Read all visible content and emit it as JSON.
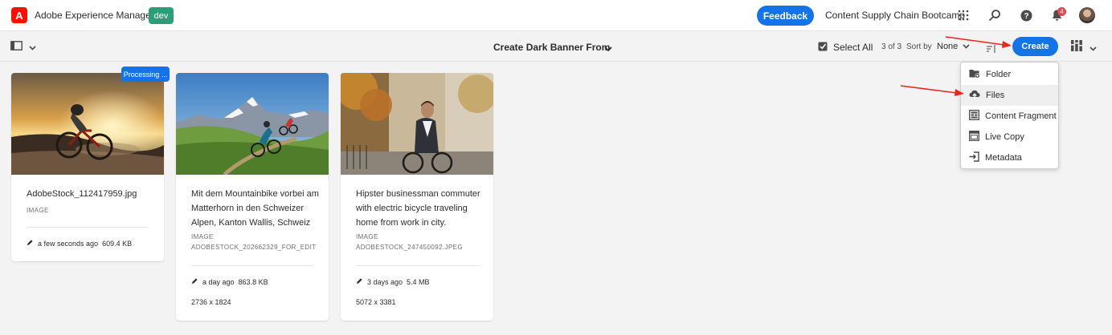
{
  "header": {
    "logo_glyph": "A",
    "app_title": "Adobe Experience Manager",
    "env_badge": "dev",
    "feedback_label": "Feedback",
    "org_name": "Content Supply Chain Bootcamp",
    "notification_count": "4",
    "icons": [
      "apps-grid-icon",
      "search-icon",
      "help-icon",
      "bell-icon",
      "avatar"
    ]
  },
  "actionbar": {
    "folder_title": "Create Dark Banner From",
    "select_all_label": "Select All",
    "count_text": "3 of 3",
    "sort_label": "Sort by",
    "sort_value": "None",
    "create_label": "Create"
  },
  "cards": [
    {
      "title": "AdobeStock_112417959.jpg",
      "type": "IMAGE",
      "filename": "",
      "modified": "a few seconds ago",
      "size": "609.4 KB",
      "dimensions": "",
      "badge": "Processing ..."
    },
    {
      "title": "Mit dem Mountainbike vorbei am Matterhorn in den Schweizer Alpen, Kanton Wallis, Schweiz",
      "type": "IMAGE",
      "filename": "ADOBESTOCK_202662329_FOR_EDIT",
      "modified": "a day ago",
      "size": "863.8 KB",
      "dimensions": "2736 x 1824",
      "badge": ""
    },
    {
      "title": "Hipster businessman commuter with electric bicycle traveling home from work in city.",
      "type": "IMAGE",
      "filename": "ADOBESTOCK_247450092.JPEG",
      "modified": "3 days ago",
      "size": "5.4 MB",
      "dimensions": "5072 x 3381",
      "badge": ""
    }
  ],
  "create_menu": {
    "items": [
      {
        "label": "Folder",
        "icon": "folder-add-icon"
      },
      {
        "label": "Files",
        "icon": "cloud-upload-icon"
      },
      {
        "label": "Content Fragment",
        "icon": "content-fragment-icon"
      },
      {
        "label": "Live Copy",
        "icon": "live-copy-icon"
      },
      {
        "label": "Metadata",
        "icon": "metadata-import-icon"
      }
    ]
  },
  "colors": {
    "accent": "#1473e6",
    "brand_red": "#fa0f00",
    "env_green": "#2d9d78",
    "annotation_red": "#e8281e"
  }
}
